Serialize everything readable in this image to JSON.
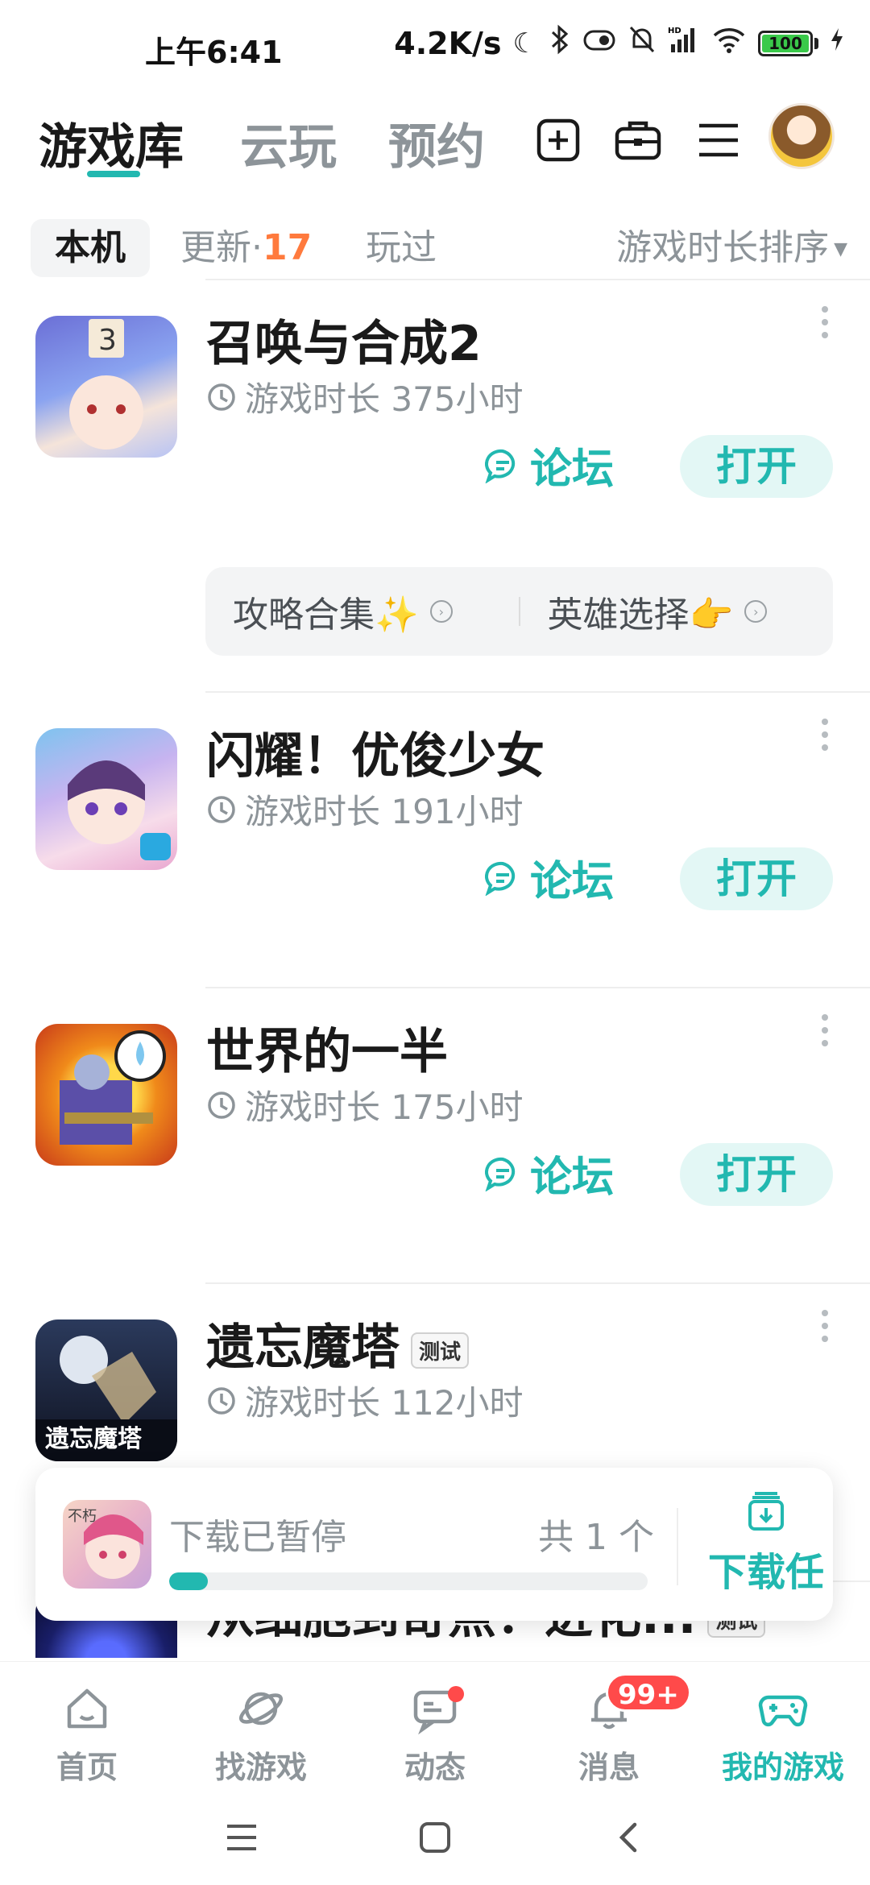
{
  "status_bar": {
    "time": "上午6:41",
    "network_speed": "4.2K/s",
    "battery": "100"
  },
  "top_nav": {
    "tabs": [
      {
        "label": "游戏库",
        "active": true
      },
      {
        "label": "云玩",
        "active": false
      },
      {
        "label": "预约",
        "active": false
      }
    ],
    "icons": [
      "add-square-icon",
      "toolbox-icon",
      "menu-icon"
    ]
  },
  "filter": {
    "chips": {
      "local": "本机",
      "update": "更新·",
      "update_count": "17",
      "played": "玩过"
    },
    "sort_label": "游戏时长排序"
  },
  "games": [
    {
      "title": "召唤与合成2",
      "playtime": "游戏时长 375小时",
      "test_badge": "",
      "forum_label": "论坛",
      "open_label": "打开",
      "extra_links": [
        "攻略合集✨",
        "英雄选择👉"
      ]
    },
    {
      "title": "闪耀！优俊少女",
      "playtime": "游戏时长 191小时",
      "test_badge": "",
      "forum_label": "论坛",
      "open_label": "打开"
    },
    {
      "title": "世界的一半",
      "playtime": "游戏时长 175小时",
      "test_badge": "",
      "forum_label": "论坛",
      "open_label": "打开"
    },
    {
      "title": "遗忘魔塔",
      "playtime": "游戏时长 112小时",
      "test_badge": "测试"
    },
    {
      "title": "从细胞到奇点：进化...",
      "test_badge": "测试"
    }
  ],
  "download_bar": {
    "status": "下载已暂停",
    "count": "共 1 个",
    "progress": 0.08,
    "task_label": "下载任"
  },
  "bottom_nav": [
    {
      "label": "首页",
      "icon": "home-icon",
      "active": false
    },
    {
      "label": "找游戏",
      "icon": "planet-icon",
      "active": false
    },
    {
      "label": "动态",
      "icon": "feed-icon",
      "active": false
    },
    {
      "label": "消息",
      "icon": "bell-icon",
      "active": false,
      "badge": "99+"
    },
    {
      "label": "我的游戏",
      "icon": "gamepad-icon",
      "active": true
    }
  ],
  "colors": {
    "accent": "#22b8b0",
    "update_count": "#ff7a3d",
    "badge": "#ff4a4a"
  }
}
